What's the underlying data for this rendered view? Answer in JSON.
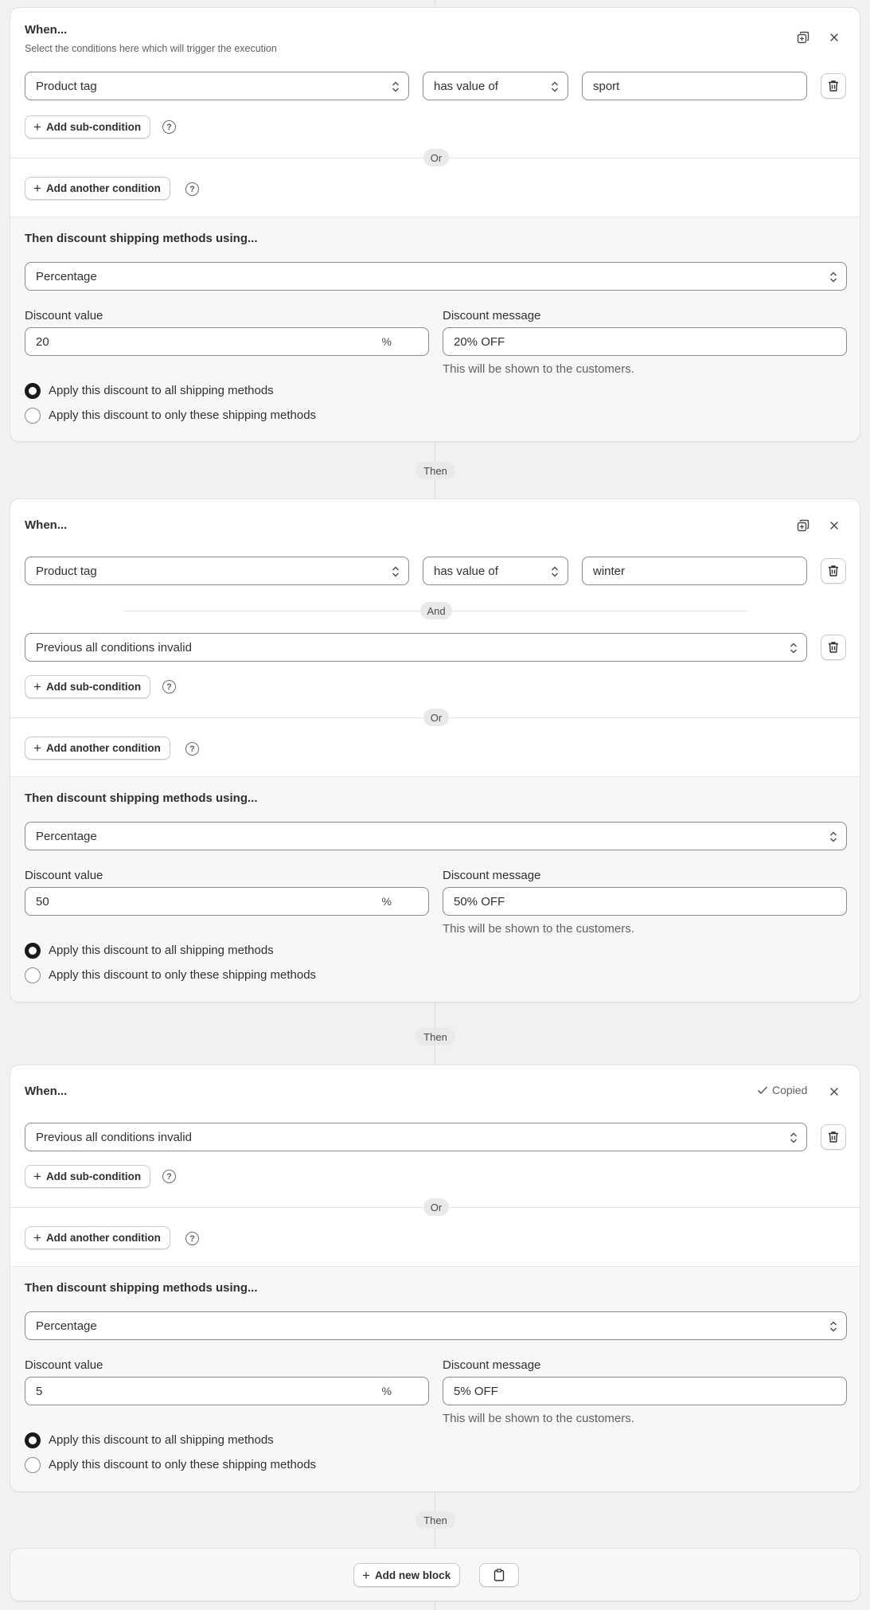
{
  "blocks": [
    {
      "when_title": "When...",
      "when_subtitle": "Select the conditions here which will trigger the execution",
      "conditions": [
        {
          "field": "Product tag",
          "operator": "has value of",
          "value": "sport"
        }
      ],
      "add_sub_condition_label": "Add sub-condition",
      "or_label": "Or",
      "add_another_condition_label": "Add another condition",
      "then_title": "Then discount shipping methods using...",
      "discount_type": "Percentage",
      "discount_value_label": "Discount value",
      "discount_value": "20",
      "discount_suffix": "%",
      "discount_message_label": "Discount message",
      "discount_message": "20% OFF",
      "discount_message_help": "This will be shown to the customers.",
      "radio_all_label": "Apply this discount to all shipping methods",
      "radio_only_label": "Apply this discount to only these shipping methods",
      "selected_radio": "all"
    },
    {
      "when_title": "When...",
      "conditions": [
        {
          "field": "Product tag",
          "operator": "has value of",
          "value": "winter"
        },
        {
          "field": "Previous all conditions invalid"
        }
      ],
      "and_label": "And",
      "add_sub_condition_label": "Add sub-condition",
      "or_label": "Or",
      "add_another_condition_label": "Add another condition",
      "then_title": "Then discount shipping methods using...",
      "discount_type": "Percentage",
      "discount_value_label": "Discount value",
      "discount_value": "50",
      "discount_suffix": "%",
      "discount_message_label": "Discount message",
      "discount_message": "50% OFF",
      "discount_message_help": "This will be shown to the customers.",
      "radio_all_label": "Apply this discount to all shipping methods",
      "radio_only_label": "Apply this discount to only these shipping methods",
      "selected_radio": "all"
    },
    {
      "when_title": "When...",
      "copied_label": "Copied",
      "conditions": [
        {
          "field": "Previous all conditions invalid"
        }
      ],
      "add_sub_condition_label": "Add sub-condition",
      "or_label": "Or",
      "add_another_condition_label": "Add another condition",
      "then_title": "Then discount shipping methods using...",
      "discount_type": "Percentage",
      "discount_value_label": "Discount value",
      "discount_value": "5",
      "discount_suffix": "%",
      "discount_message_label": "Discount message",
      "discount_message": "5% OFF",
      "discount_message_help": "This will be shown to the customers.",
      "radio_all_label": "Apply this discount to all shipping methods",
      "radio_only_label": "Apply this discount to only these shipping methods",
      "selected_radio": "all"
    }
  ],
  "then_connector_label": "Then",
  "footer": {
    "add_new_block_label": "Add new block",
    "paste_icon": "clipboard-icon"
  },
  "icons": {
    "duplicate": "duplicate-icon",
    "close": "close-icon",
    "delete": "trash-icon",
    "help": "question-circle-icon",
    "chevron": "select-chevron-icon",
    "check": "check-icon"
  }
}
